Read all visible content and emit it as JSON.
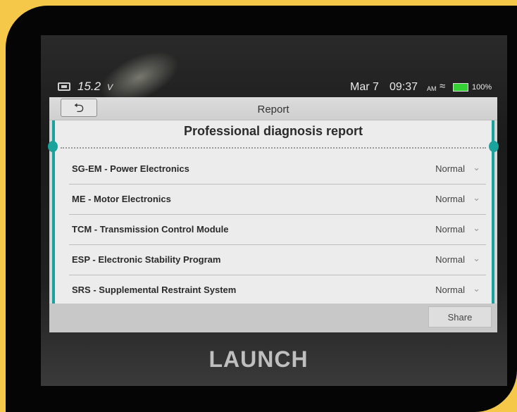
{
  "status_bar": {
    "voltage": "15.2",
    "voltage_unit": "V",
    "date": "Mar 7",
    "time": "09:37",
    "ampm": "AM",
    "battery": "100%",
    "icons": [
      "battery-icon",
      "wifi-icon"
    ]
  },
  "header": {
    "back_icon": "back-arrow-icon",
    "title": "Report"
  },
  "report": {
    "heading": "Professional diagnosis report",
    "rows": [
      {
        "name": "SG-EM - Power Electronics",
        "status": "Normal"
      },
      {
        "name": "ME - Motor Electronics",
        "status": "Normal"
      },
      {
        "name": "TCM - Transmission Control Module",
        "status": "Normal"
      },
      {
        "name": "ESP - Electronic Stability Program",
        "status": "Normal"
      },
      {
        "name": "SRS - Supplemental Restraint System",
        "status": "Normal"
      }
    ]
  },
  "footer": {
    "share_label": "Share"
  },
  "device_logo": "LAUNCH",
  "colors": {
    "accent": "#1aa39c",
    "frame": "#f6c84a"
  }
}
